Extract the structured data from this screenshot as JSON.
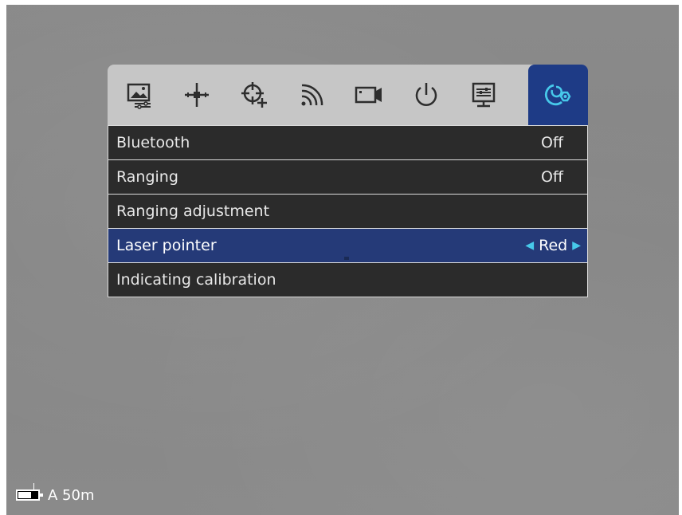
{
  "toolbar": {
    "tabs": [
      {
        "icon": "image-settings-icon",
        "active": false
      },
      {
        "icon": "crosshair-icon",
        "active": false
      },
      {
        "icon": "reticle-add-icon",
        "active": false
      },
      {
        "icon": "wifi-signal-icon",
        "active": false
      },
      {
        "icon": "video-camera-icon",
        "active": false
      },
      {
        "icon": "power-icon",
        "active": false
      },
      {
        "icon": "display-settings-icon",
        "active": false
      },
      {
        "icon": "advanced-settings-icon",
        "active": true
      }
    ],
    "active_color": "#1e3b86",
    "icon_color": "#2d2d2d",
    "active_icon_color": "#47c9ea"
  },
  "menu": {
    "rows": [
      {
        "label": "Bluetooth",
        "value": "Off"
      },
      {
        "label": "Ranging",
        "value": "Off"
      },
      {
        "label": "Ranging adjustment",
        "value": ""
      },
      {
        "label": "Laser pointer",
        "value": "Red",
        "selected": true
      },
      {
        "label": "Indicating calibration",
        "value": ""
      }
    ],
    "selected_color": "#253a78"
  },
  "status": {
    "mode_range": "A 50m"
  }
}
